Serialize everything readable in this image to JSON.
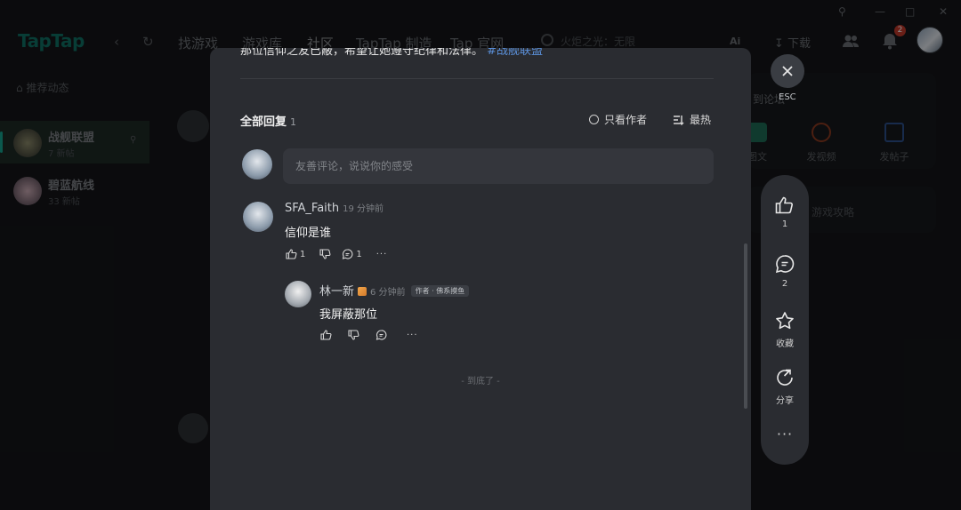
{
  "window": {
    "logo": "TapTap",
    "nav": [
      "找游戏",
      "游戏库",
      "社区",
      "TapTap 制造",
      "Tap 官网"
    ],
    "active_nav": "社区",
    "search_placeholder": "火炬之光：无限",
    "ai_label": "Ai",
    "download_label": "下载",
    "notification_count": "2"
  },
  "sidebar": {
    "home_label": "推荐动态",
    "items": [
      {
        "title": "战舰联盟",
        "sub": "7 新帖"
      },
      {
        "title": "碧蓝航线",
        "sub": "33 新帖"
      }
    ]
  },
  "right_panel": {
    "title": "到论坛",
    "actions": [
      "图文",
      "发视频",
      "发帖子"
    ],
    "row_text": "游戏攻略"
  },
  "modal": {
    "post_text": "那位信仰之友已蔽，希望让她遵守纪律和法律。",
    "post_tag": "#战舰联盟",
    "replies_title": "全部回复",
    "replies_count": "1",
    "author_only_label": "只看作者",
    "sort_label": "最热",
    "comment_placeholder": "友善评论，说说你的感受",
    "comments": [
      {
        "name": "SFA_Faith",
        "time": "19 分钟前",
        "text": "信仰是谁",
        "likes": "1",
        "replies": "1"
      }
    ],
    "reply": {
      "name": "林一新",
      "time": "6 分钟前",
      "tag": "作者 · 佛系摸鱼",
      "text": "我屏蔽那位"
    },
    "end_text": "- 到底了 -"
  },
  "close": {
    "esc_label": "ESC"
  },
  "float_bar": {
    "like_count": "1",
    "comment_count": "2",
    "favorite_label": "收藏",
    "share_label": "分享"
  },
  "colors": {
    "accent": "#14a08c",
    "modal_bg": "#2a2c31",
    "tag_blue": "#5a8fd8"
  }
}
